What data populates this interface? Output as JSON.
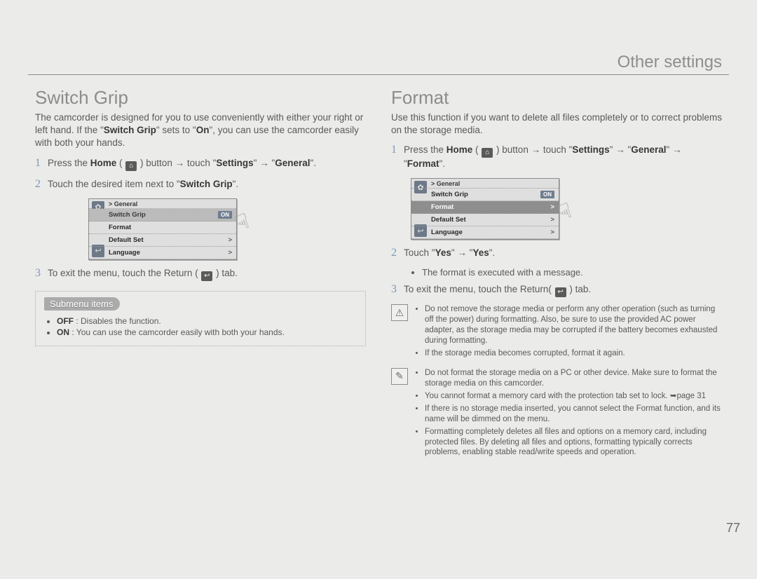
{
  "header": "Other settings",
  "page_number": "77",
  "left": {
    "title": "Switch Grip",
    "intro_a": "The camcorder is designed for you to use conveniently with either your right or left hand. If the \"",
    "intro_b": "Switch Grip",
    "intro_c": "\" sets to \"",
    "intro_d": "On",
    "intro_e": "\", you can use the camcorder easily with both your hands.",
    "step1_a": "Press the ",
    "step1_b": "Home",
    "step1_c": " ( ",
    "step1_d": " ) button → touch \"",
    "step1_e": "Settings",
    "step1_f": "\" → \"",
    "step1_g": "General",
    "step1_h": "\".",
    "step2_a": "Touch the desired item next to \"",
    "step2_b": "Switch Grip",
    "step2_c": "\".",
    "step3_a": "To exit the menu, touch the Return ( ",
    "step3_b": " ) tab.",
    "shot": {
      "bc": "> General",
      "r1": "Switch Grip",
      "r1_tag": "ON",
      "r2": "Format",
      "r3": "Default Set",
      "r4": "Language"
    },
    "submenu_title": "Submenu items",
    "sub_off_k": "OFF",
    "sub_off_v": " : Disables the function.",
    "sub_on_k": "ON",
    "sub_on_v": " : You can use the camcorder easily with both your hands."
  },
  "right": {
    "title": "Format",
    "intro": "Use this function if you want to delete all files completely or to correct problems on the storage media.",
    "step1_a": "Press the ",
    "step1_b": "Home",
    "step1_c": " ( ",
    "step1_d": " ) button → touch \"",
    "step1_e": "Settings",
    "step1_f": "\" → \"",
    "step1_g": "General",
    "step1_h": "\" → \"",
    "step1_i": "Format",
    "step1_j": "\".",
    "shot": {
      "bc": "> General",
      "r1": "Switch Grip",
      "r1_tag": "ON",
      "r2": "Format",
      "r3": "Default Set",
      "r4": "Language"
    },
    "step2_a": "Touch \"",
    "step2_b": "Yes",
    "step2_c": "\" → \"",
    "step2_d": "Yes",
    "step2_e": "\".",
    "step2_bullet": "The format is executed with a message.",
    "step3_a": "To exit the menu, touch the Return( ",
    "step3_b": " ) tab.",
    "warn": {
      "b1": "Do not remove the storage media or perform any other operation (such as turning off the power) during formatting. Also, be sure to use the provided AC power adapter, as the storage media may be corrupted if the battery becomes exhausted during formatting.",
      "b2": "If the storage media becomes corrupted, format it again."
    },
    "note": {
      "b1": "Do not format the storage media on a PC or other device. Make sure to format the storage media on this camcorder.",
      "b2": "You cannot format a memory card with the protection tab set to lock. ➥page 31",
      "b3": "If there is no storage media inserted, you cannot select the Format function, and its name will be dimmed on the menu.",
      "b4": "Formatting completely deletes all files and options on a memory card, including protected files. By deleting all files and options, formatting typically corrects problems, enabling stable read/write speeds and operation."
    }
  }
}
